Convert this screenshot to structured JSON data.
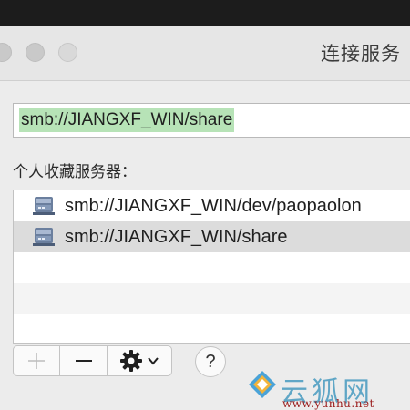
{
  "window": {
    "title": "连接服务"
  },
  "address": {
    "value": "smb://JIANGXF_WIN/share"
  },
  "favorites": {
    "label": "个人收藏服务器：",
    "items": [
      {
        "label": "smb://JIANGXF_WIN/dev/paopaolon",
        "icon": "network-drive-icon",
        "selected": false
      },
      {
        "label": "smb://JIANGXF_WIN/share",
        "icon": "network-drive-icon",
        "selected": true
      }
    ]
  },
  "toolbar": {
    "add_icon": "plus-icon",
    "remove_icon": "minus-icon",
    "actions_icon": "gear-icon",
    "help_label": "?"
  },
  "watermark": {
    "text": "云狐网",
    "url": "www.yunhu.net",
    "logo": "yunhu-logo-icon"
  },
  "colors": {
    "selection_highlight": "#b7e3b7",
    "selected_row": "#dcdcdc",
    "window_bg": "#ececec",
    "watermark_text": "#5fa6c6",
    "watermark_url": "#9a1a1a"
  }
}
